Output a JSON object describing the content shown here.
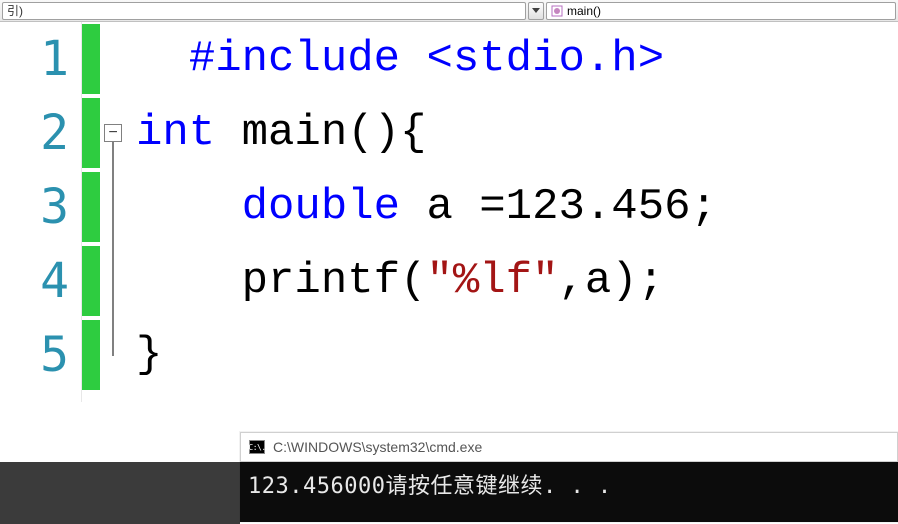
{
  "toolbar": {
    "left_text": "引)",
    "function_label": "main()"
  },
  "code": {
    "lines": [
      {
        "num": "1",
        "segments": [
          {
            "cls": "tok-preproc",
            "text": "#include "
          },
          {
            "cls": "tok-include-path",
            "text": "<stdio.h>"
          }
        ],
        "indent": "  "
      },
      {
        "num": "2",
        "segments": [
          {
            "cls": "tok-keyword",
            "text": "int"
          },
          {
            "cls": "tok-plain",
            "text": " main(){"
          }
        ],
        "indent": "",
        "fold": true
      },
      {
        "num": "3",
        "segments": [
          {
            "cls": "tok-keyword",
            "text": "double"
          },
          {
            "cls": "tok-plain",
            "text": " a =123.456;"
          }
        ],
        "indent": "    "
      },
      {
        "num": "4",
        "segments": [
          {
            "cls": "tok-plain",
            "text": "printf("
          },
          {
            "cls": "tok-string",
            "text": "\"%lf\""
          },
          {
            "cls": "tok-plain",
            "text": ",a);"
          }
        ],
        "indent": "    "
      },
      {
        "num": "5",
        "segments": [
          {
            "cls": "tok-plain",
            "text": "}"
          }
        ],
        "indent": ""
      }
    ]
  },
  "cmd": {
    "icon_text": "C:\\.",
    "title": "C:\\WINDOWS\\system32\\cmd.exe",
    "output": "123.456000请按任意键继续. . ."
  }
}
